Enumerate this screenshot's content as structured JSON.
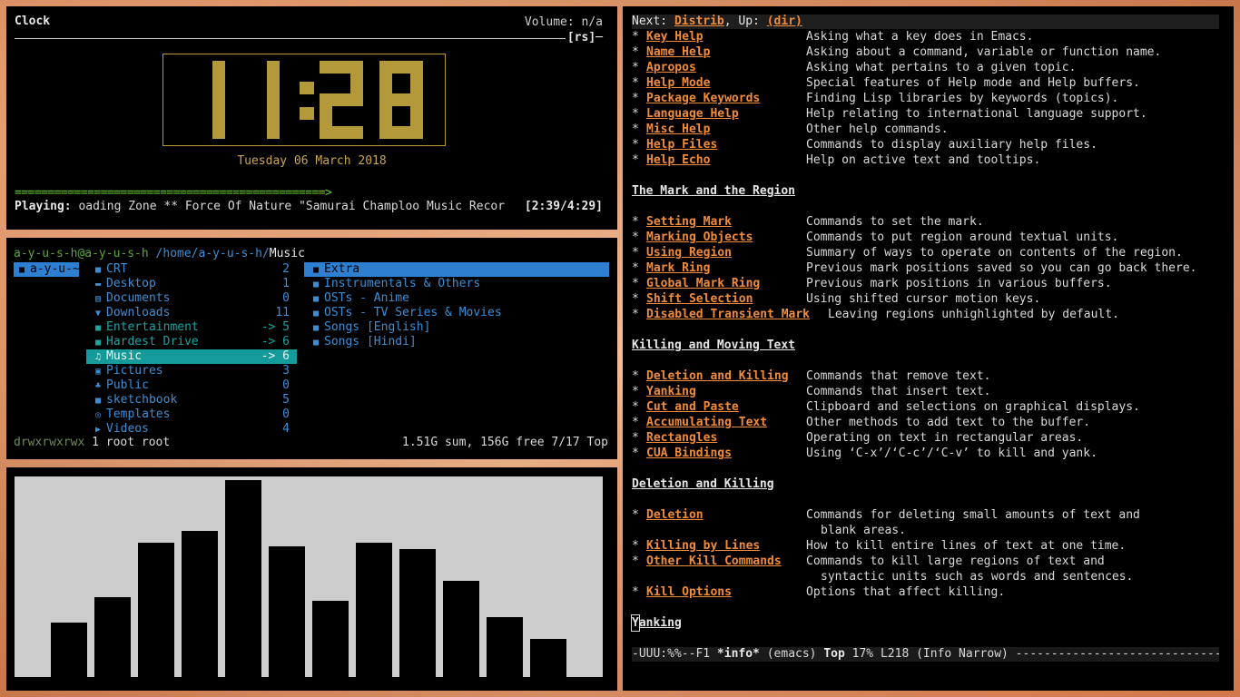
{
  "clock": {
    "title": "Clock",
    "volume": "Volume: n/a",
    "rs": "[rs]─",
    "time": "11:28",
    "date": "Tuesday 06 March 2018",
    "progress": "===============================================>",
    "playing_label": "Playing:",
    "track": "oading Zone ** Force Of Nature \"Samurai Champloo Music Recor",
    "track_time": "[2:39/4:29]",
    "colors": {
      "digits": "#b4993b",
      "progress": "#6acc33"
    }
  },
  "ranger": {
    "user": "a-y-u-s-h@a-y-u-s-h",
    "path": "/home/a-y-u-s-h/",
    "current": "Music",
    "parent": [
      {
        "icon": "folder-icon",
        "glyph": "■",
        "name": "a-y-u-~",
        "selected": true
      }
    ],
    "items": [
      {
        "icon": "folder-icon",
        "glyph": "■",
        "name": "CRT",
        "count": "2",
        "style": ""
      },
      {
        "icon": "desktop-icon",
        "glyph": "▬",
        "name": "Desktop",
        "count": "1",
        "style": ""
      },
      {
        "icon": "document-icon",
        "glyph": "▤",
        "name": "Documents",
        "count": "0",
        "style": ""
      },
      {
        "icon": "download-icon",
        "glyph": "▼",
        "name": "Downloads",
        "count": "11",
        "style": ""
      },
      {
        "icon": "folder-icon",
        "glyph": "■",
        "name": "Entertainment",
        "count": "-> 5",
        "style": "cyan"
      },
      {
        "icon": "folder-icon",
        "glyph": "■",
        "name": "Hardest Drive",
        "count": "-> 6",
        "style": "cyan"
      },
      {
        "icon": "headphones-icon",
        "glyph": "♫",
        "name": "Music",
        "count": "-> 6",
        "style": "sel-teal"
      },
      {
        "icon": "picture-icon",
        "glyph": "▣",
        "name": "Pictures",
        "count": "3",
        "style": ""
      },
      {
        "icon": "users-icon",
        "glyph": "♣",
        "name": "Public",
        "count": "0",
        "style": ""
      },
      {
        "icon": "folder-icon",
        "glyph": "■",
        "name": "sketchbook",
        "count": "5",
        "style": ""
      },
      {
        "icon": "template-icon",
        "glyph": "◎",
        "name": "Templates",
        "count": "0",
        "style": ""
      },
      {
        "icon": "video-icon",
        "glyph": "▶",
        "name": "Videos",
        "count": "4",
        "style": ""
      }
    ],
    "preview": [
      {
        "icon": "folder-icon",
        "glyph": "■",
        "name": "Extra",
        "selected": true
      },
      {
        "icon": "folder-icon",
        "glyph": "■",
        "name": "Instrumentals & Others",
        "selected": false
      },
      {
        "icon": "folder-icon",
        "glyph": "■",
        "name": "OSTs - Anime",
        "selected": false
      },
      {
        "icon": "folder-icon",
        "glyph": "■",
        "name": "OSTs - TV Series & Movies",
        "selected": false
      },
      {
        "icon": "folder-icon",
        "glyph": "■",
        "name": "Songs [English]",
        "selected": false
      },
      {
        "icon": "folder-icon",
        "glyph": "■",
        "name": "Songs [Hindi]",
        "selected": false
      }
    ],
    "status": {
      "perms": "drwxrwxrwx",
      "owner": "1 root root",
      "info": "1.51G sum, 156G free  7/17  Top"
    }
  },
  "visualizer": {
    "bars": [
      0.27,
      0.4,
      0.67,
      0.73,
      0.98,
      0.65,
      0.38,
      0.67,
      0.64,
      0.48,
      0.3,
      0.19
    ],
    "colors": {
      "background": "#cccccc",
      "bar": "#000000"
    }
  },
  "emacs": {
    "header": {
      "next_label": "Next:",
      "next": "Distrib",
      "sep": ",  ",
      "up_label": "Up:",
      "up": "(dir)"
    },
    "lines": [
      {
        "kind": "item",
        "link": "Key Help",
        "desc": "Asking what a key does in Emacs."
      },
      {
        "kind": "item",
        "link": "Name Help",
        "desc": "Asking about a command, variable or function name."
      },
      {
        "kind": "item",
        "link": "Apropos",
        "desc": "Asking what pertains to a given topic."
      },
      {
        "kind": "item",
        "link": "Help Mode",
        "desc": "Special features of Help mode and Help buffers."
      },
      {
        "kind": "item",
        "link": "Package Keywords",
        "desc": "Finding Lisp libraries by keywords (topics)."
      },
      {
        "kind": "item",
        "link": "Language Help",
        "desc": "Help relating to international language support."
      },
      {
        "kind": "item",
        "link": "Misc Help",
        "desc": "Other help commands."
      },
      {
        "kind": "item",
        "link": "Help Files",
        "desc": "Commands to display auxiliary help files."
      },
      {
        "kind": "item",
        "link": "Help Echo",
        "desc": "Help on active text and tooltips."
      },
      {
        "kind": "blank"
      },
      {
        "kind": "section",
        "text": "The Mark and the Region"
      },
      {
        "kind": "blank"
      },
      {
        "kind": "item",
        "link": "Setting Mark",
        "desc": "Commands to set the mark."
      },
      {
        "kind": "item",
        "link": "Marking Objects",
        "desc": "Commands to put region around textual units."
      },
      {
        "kind": "item",
        "link": "Using Region",
        "desc": "Summary of ways to operate on contents of the region."
      },
      {
        "kind": "item",
        "link": "Mark Ring",
        "desc": "Previous mark positions saved so you can go back there."
      },
      {
        "kind": "item",
        "link": "Global Mark Ring",
        "desc": "Previous mark positions in various buffers."
      },
      {
        "kind": "item",
        "link": "Shift Selection",
        "desc": "Using shifted cursor motion keys."
      },
      {
        "kind": "item",
        "link": "Disabled Transient Mark",
        "desc": "Leaving regions unhighlighted by default.",
        "offset": true
      },
      {
        "kind": "blank"
      },
      {
        "kind": "section",
        "text": "Killing and Moving Text"
      },
      {
        "kind": "blank"
      },
      {
        "kind": "item",
        "link": "Deletion and Killing",
        "desc": "Commands that remove text."
      },
      {
        "kind": "item",
        "link": "Yanking",
        "desc": "Commands that insert text."
      },
      {
        "kind": "item",
        "link": "Cut and Paste",
        "desc": "Clipboard and selections on graphical displays."
      },
      {
        "kind": "item",
        "link": "Accumulating Text",
        "desc": "Other methods to add text to the buffer."
      },
      {
        "kind": "item",
        "link": "Rectangles",
        "desc": "Operating on text in rectangular areas."
      },
      {
        "kind": "item",
        "link": "CUA Bindings",
        "desc": "Using ‘C-x’/‘C-c’/‘C-v’ to kill and yank."
      },
      {
        "kind": "blank"
      },
      {
        "kind": "section",
        "text": "Deletion and Killing"
      },
      {
        "kind": "blank"
      },
      {
        "kind": "item",
        "link": "Deletion",
        "desc": "Commands for deleting small amounts of text and"
      },
      {
        "kind": "cont",
        "desc": "blank areas."
      },
      {
        "kind": "item",
        "link": "Killing by Lines",
        "desc": "How to kill entire lines of text at one time."
      },
      {
        "kind": "item",
        "link": "Other Kill Commands",
        "desc": "Commands to kill large regions of text and"
      },
      {
        "kind": "cont",
        "desc": "syntactic units such as words and sentences."
      },
      {
        "kind": "item",
        "link": "Kill Options",
        "desc": "Options that affect killing."
      },
      {
        "kind": "blank"
      },
      {
        "kind": "cursor-section",
        "first": "Y",
        "rest": "anking"
      }
    ],
    "modeline": {
      "left": "-UUU:%%--F1  ",
      "buffer": "*info*",
      "mode": " (emacs) ",
      "pos": "Top",
      "rest": "   17% L218   (Info Narrow) ------------------------------------------"
    }
  }
}
